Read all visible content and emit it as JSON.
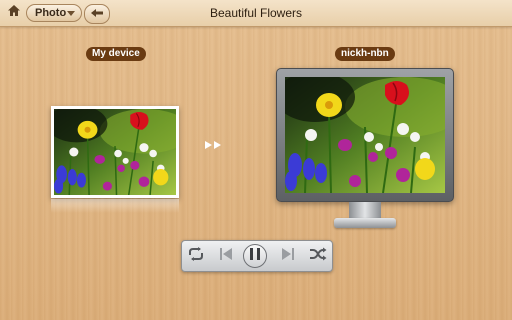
{
  "header": {
    "title": "Beautiful Flowers",
    "category_select": "Photo",
    "icons": {
      "home": "home-icon",
      "back": "back-arrow-icon",
      "dropdown": "chevron-down-icon"
    }
  },
  "source_device": {
    "label": "My device"
  },
  "target_device": {
    "label": "nickh-nbn"
  },
  "transfer": {
    "icon": "double-arrow-right-icon"
  },
  "player": {
    "state": "playing",
    "buttons": [
      "repeat-icon",
      "previous-icon",
      "pause-icon",
      "next-icon",
      "shuffle-icon"
    ]
  },
  "colors": {
    "label_pill": "#6a3b12",
    "wood": "#e2b886",
    "header_bg": "#f0ddc0"
  }
}
